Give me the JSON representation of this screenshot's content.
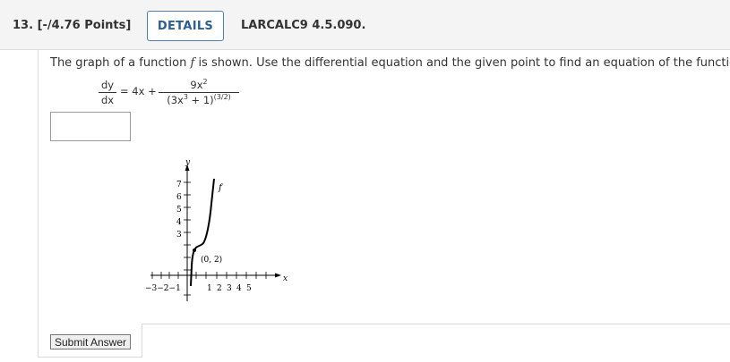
{
  "header": {
    "question_number": "13.",
    "points": "[-/4.76 Points]",
    "details_label": "DETAILS",
    "problem_code": "LARCALC9 4.5.090."
  },
  "problem": {
    "prompt_before_f": "The graph of a function ",
    "function_name": "f",
    "prompt_after_f": " is shown. Use the differential equation and the given point to find an equation of the function.",
    "dy": "dy",
    "dx": "dx",
    "equals_term": "= 4x +",
    "rhs_numerator": "9x",
    "rhs_numerator_exp": "2",
    "rhs_denominator_a": "(3x",
    "rhs_denominator_exp": "3",
    "rhs_denominator_b": " + 1)",
    "rhs_denominator_outer_exp": "(3/2)"
  },
  "answer": {
    "value": ""
  },
  "graph": {
    "y_axis_label": "y",
    "x_axis_label": "x",
    "curve_label": "f",
    "point_label": "(0, 2)",
    "y_ticks": [
      "7",
      "6",
      "5",
      "4",
      "3"
    ],
    "x_ticks_neg": "−3−2−1",
    "x_ticks_pos": [
      "1",
      "2",
      "3",
      "4",
      "5"
    ],
    "point": [
      0,
      2
    ]
  },
  "submit_label": "Submit Answer"
}
